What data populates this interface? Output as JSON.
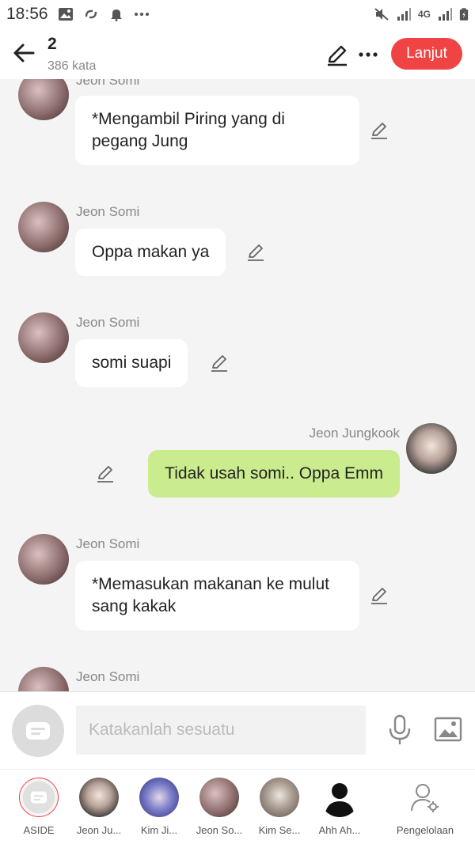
{
  "status_bar": {
    "time": "18:56",
    "left_icons": [
      "image-icon",
      "sync-icon",
      "bell-icon",
      "more-dots-icon"
    ],
    "right_icons": [
      "mute-icon",
      "signal-icon",
      "4g-icon",
      "signal-icon",
      "battery-icon"
    ],
    "network": "4G"
  },
  "header": {
    "chapter_title": "2",
    "word_count": "386 kata",
    "next_label": "Lanjut",
    "accent_color": "#f04444"
  },
  "messages": [
    {
      "sender": "Jeon Somi",
      "text": "*Mengambil Piring yang di pegang Jung",
      "side": "left"
    },
    {
      "sender": "Jeon Somi",
      "text": "Oppa makan ya",
      "side": "left"
    },
    {
      "sender": "Jeon Somi",
      "text": "somi suapi",
      "side": "left"
    },
    {
      "sender": "Jeon Jungkook",
      "text": "Tidak usah somi.. Oppa Emm",
      "side": "right"
    },
    {
      "sender": "Jeon Somi",
      "text": "*Memasukan makanan ke mulut sang kakak",
      "side": "left"
    },
    {
      "sender": "Jeon Somi",
      "text": "",
      "side": "left"
    }
  ],
  "input": {
    "placeholder": "Katakanlah sesuatu"
  },
  "characters": [
    {
      "label": "ASIDE"
    },
    {
      "label": "Jeon Ju..."
    },
    {
      "label": "Kim Ji..."
    },
    {
      "label": "Jeon So..."
    },
    {
      "label": "Kim Se..."
    },
    {
      "label": "Ahh Ah..."
    },
    {
      "label": "Pengelolaan"
    }
  ],
  "colors": {
    "bubble_self": "#cbec8e",
    "bubble_other": "#ffffff",
    "background": "#f4f4f4"
  }
}
